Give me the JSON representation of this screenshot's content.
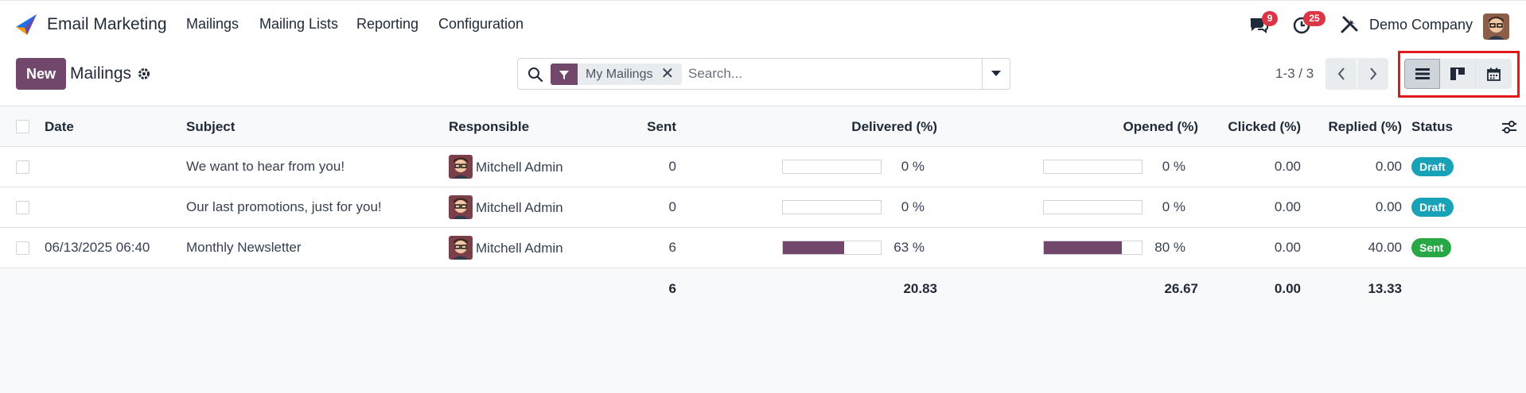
{
  "app": {
    "name": "Email Marketing",
    "brand_color": "#71486c"
  },
  "menu": {
    "mailings": "Mailings",
    "mailing_lists": "Mailing Lists",
    "reporting": "Reporting",
    "configuration": "Configuration"
  },
  "systray": {
    "messages_count": "9",
    "activities_count": "25",
    "company": "Demo Company"
  },
  "control": {
    "new_label": "New",
    "title": "Mailings",
    "facet_label": "My Mailings",
    "search_placeholder": "Search...",
    "pager": "1-3 / 3"
  },
  "table": {
    "headers": {
      "date": "Date",
      "subject": "Subject",
      "responsible": "Responsible",
      "sent": "Sent",
      "delivered": "Delivered (%)",
      "opened": "Opened (%)",
      "clicked": "Clicked (%)",
      "replied": "Replied (%)",
      "status": "Status"
    },
    "rows": [
      {
        "date": "",
        "subject": "We want to hear from you!",
        "responsible": "Mitchell Admin",
        "sent": "0",
        "delivered": "0 %",
        "delivered_pct": 0,
        "opened": "0 %",
        "opened_pct": 0,
        "clicked": "0.00",
        "replied": "0.00",
        "status": "Draft"
      },
      {
        "date": "",
        "subject": "Our last promotions, just for you!",
        "responsible": "Mitchell Admin",
        "sent": "0",
        "delivered": "0 %",
        "delivered_pct": 0,
        "opened": "0 %",
        "opened_pct": 0,
        "clicked": "0.00",
        "replied": "0.00",
        "status": "Draft"
      },
      {
        "date": "06/13/2025 06:40",
        "subject": "Monthly Newsletter",
        "responsible": "Mitchell Admin",
        "sent": "6",
        "delivered": "63 %",
        "delivered_pct": 63,
        "opened": "80 %",
        "opened_pct": 80,
        "clicked": "0.00",
        "replied": "40.00",
        "status": "Sent"
      }
    ],
    "totals": {
      "sent": "6",
      "delivered": "20.83",
      "opened": "26.67",
      "clicked": "0.00",
      "replied": "13.33"
    }
  },
  "icons": [
    "app-logo-icon",
    "chat-icon",
    "activity-clock-icon",
    "tools-icon",
    "gear-icon",
    "search-icon",
    "filter-icon",
    "close-icon",
    "caret-down-icon",
    "chevron-left-icon",
    "chevron-right-icon",
    "list-view-icon",
    "kanban-view-icon",
    "calendar-view-icon",
    "optional-columns-icon"
  ]
}
